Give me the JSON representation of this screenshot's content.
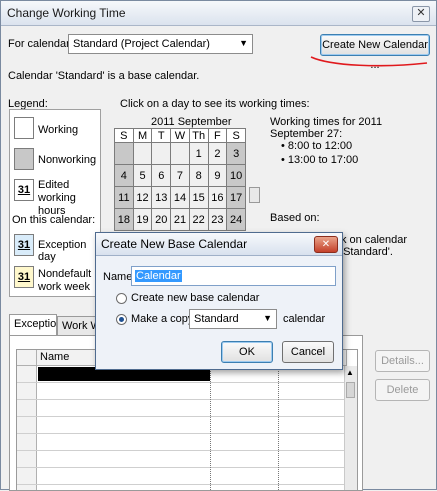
{
  "window": {
    "title": "Change Working Time",
    "close_symbol": "✕"
  },
  "for_calendar": {
    "label": "For calendar:",
    "value": "Standard (Project Calendar)"
  },
  "create_calendar_button": "Create New Calendar ...",
  "base_note": "Calendar 'Standard' is a base calendar.",
  "legend": {
    "title": "Legend:",
    "working": "Working",
    "nonworking": "Nonworking",
    "edited_hours": "Edited working hours",
    "on_this_calendar": "On this calendar:",
    "exception_day": "Exception day",
    "nondefault_week": "Nondefault work week",
    "date_31": "31"
  },
  "calendar": {
    "instruction": "Click on a day to see its working times:",
    "month": "2011 September",
    "weekdays": [
      "S",
      "M",
      "T",
      "W",
      "Th",
      "F",
      "S"
    ],
    "rows": [
      [
        "",
        "",
        "",
        "",
        "1",
        "2",
        "3"
      ],
      [
        "4",
        "5",
        "6",
        "7",
        "8",
        "9",
        "10"
      ],
      [
        "11",
        "12",
        "13",
        "14",
        "15",
        "16",
        "17"
      ],
      [
        "18",
        "19",
        "20",
        "21",
        "22",
        "23",
        "24"
      ]
    ]
  },
  "working_times": {
    "heading": "Working times for 2011 September 27:",
    "times": [
      "8:00 to 12:00",
      "13:00 to 17:00"
    ],
    "based_on": "Based on:",
    "based_detail": "k on calendar 'Standard'."
  },
  "tabs": [
    "Exceptions",
    "Work Wee"
  ],
  "grid": {
    "name_header": "Name"
  },
  "side_buttons": {
    "details": "Details...",
    "delete": "Delete"
  },
  "dialog": {
    "title": "Create New Base Calendar",
    "name_label": "Name:",
    "name_value": "Calendar",
    "option_new": "Create new base calendar",
    "option_copy": "Make a copy of",
    "copy_source": "Standard",
    "copy_suffix": "calendar",
    "ok": "OK",
    "cancel": "Cancel",
    "close_symbol": "✕"
  },
  "colors": {
    "annotation_red": "#e0191d",
    "nonworking_grey": "#c8c8c8"
  }
}
